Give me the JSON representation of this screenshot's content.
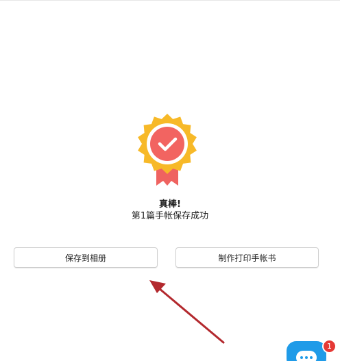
{
  "result": {
    "title": "真棒!",
    "subtitle": "第1篇手帐保存成功"
  },
  "actions": {
    "save_to_album_label": "保存到相册",
    "make_print_label": "制作打印手帐书"
  },
  "chat": {
    "unread_count": "1"
  },
  "icons": {
    "badge": "award-check-icon",
    "arrow": "annotation-arrow-icon",
    "chat": "chat-bubble-icon"
  },
  "colors": {
    "badge_gold": "#F7B928",
    "badge_check_bg": "#F26461",
    "ribbon": "#EF6360",
    "arrow": "#B3292E",
    "chat_blue": "#1F9BE8",
    "notif_red": "#E53935"
  }
}
